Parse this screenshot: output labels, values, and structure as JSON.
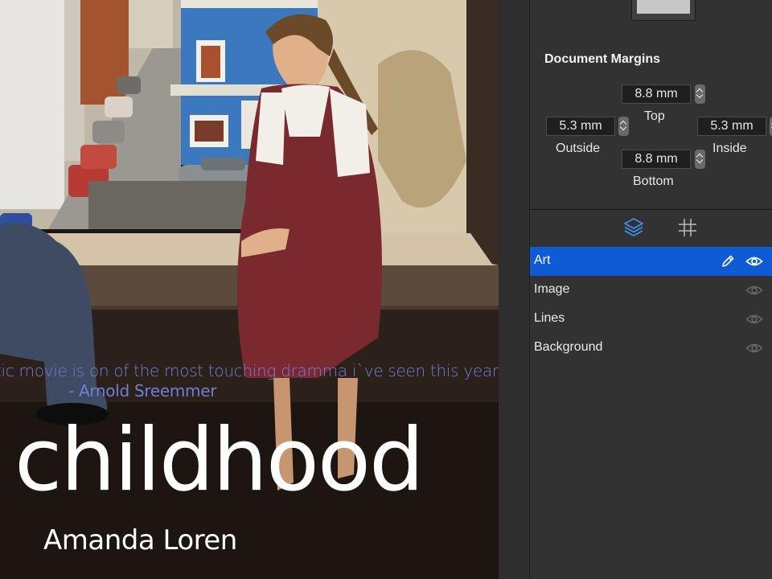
{
  "cover": {
    "quote": "tic movie is on of the most touching dramma i`ve seen this year\"",
    "quote_author": "- Arnold Sreemmer",
    "title": "childhood",
    "author": "Amanda Loren"
  },
  "margins": {
    "title": "Document Margins",
    "top": {
      "value": "8.8 mm",
      "label": "Top"
    },
    "outside": {
      "value": "5.3 mm",
      "label": "Outside"
    },
    "inside": {
      "value": "5.3 mm",
      "label": "Inside"
    },
    "bottom": {
      "value": "8.8 mm",
      "label": "Bottom"
    }
  },
  "tabs": [
    {
      "icon": "layers-icon",
      "active": true
    },
    {
      "icon": "grid-icon",
      "active": false
    }
  ],
  "layers": [
    {
      "name": "Art",
      "selected": true,
      "visible": true,
      "editable": true
    },
    {
      "name": "Image",
      "selected": false,
      "visible": true,
      "editable": false
    },
    {
      "name": "Lines",
      "selected": false,
      "visible": true,
      "editable": false
    },
    {
      "name": "Background",
      "selected": false,
      "visible": true,
      "editable": false
    }
  ],
  "colors": {
    "accent": "#0f5bd5",
    "active_tab_icon": "#3f8ef0",
    "quote_text": "#6d7fd6",
    "panel_bg": "#323232"
  }
}
